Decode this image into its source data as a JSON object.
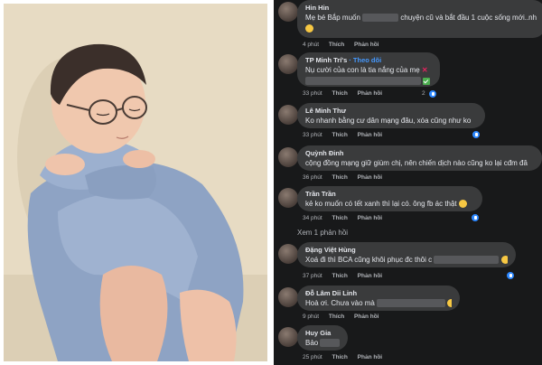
{
  "comments": [
    {
      "name": "Hin Hin",
      "text_before": "Mẹ bé Bắp muốn",
      "text_after": "chuyện cũ và bắt đầu 1 cuộc sống mới..nh",
      "time": "4 phút",
      "like": "Thích",
      "reply": "Phản hồi",
      "has_emoji_line": true
    },
    {
      "name": "TP Minh Trí's",
      "follow": "· Theo dõi",
      "text": "Nụ cười của con là tia nắng của mẹ",
      "time": "33 phút",
      "like": "Thích",
      "reply": "Phản hồi",
      "reaction_count": "2"
    },
    {
      "name": "Lê Minh Thư",
      "text": "Ko nhanh bằng cư dân mạng đâu, xóa cũng như ko",
      "time": "33 phút",
      "like": "Thích",
      "reply": "Phản hồi"
    },
    {
      "name": "Quỳnh Đinh",
      "text": "cộng đồng mạng giữ giùm chị, nên chiến dịch nào cũng ko lại cđm đâ",
      "time": "36 phút",
      "like": "Thích",
      "reply": "Phản hồi"
    },
    {
      "name": "Trần Trần",
      "text": "kẻ ko muốn có tết xanh thì lại có. ông fb ác thật",
      "time": "34 phút",
      "like": "Thích",
      "reply": "Phản hồi"
    },
    {
      "name": "Đặng Việt Hùng",
      "text": "Xoá đi thì BCA cũng khôi phục đc thôi c",
      "time": "37 phút",
      "like": "Thích",
      "reply": "Phản hồi"
    },
    {
      "name": "Đỗ Lâm Dii Linh",
      "text": "Hoà ơi. Chưa vào mà",
      "time": "9 phút",
      "like": "Thích",
      "reply": "Phản hồi"
    },
    {
      "name": "Huy Gia",
      "text": "Bảo",
      "time": "25 phút",
      "like": "Thích",
      "reply": "Phản hồi"
    }
  ],
  "more_replies": "Xem 1 phản hồi",
  "colors": {
    "panel_bg": "#18191a",
    "bubble_bg": "#3a3b3c",
    "text": "#e4e6eb",
    "secondary": "#b0b3b8",
    "like_blue": "#2d88ff"
  }
}
